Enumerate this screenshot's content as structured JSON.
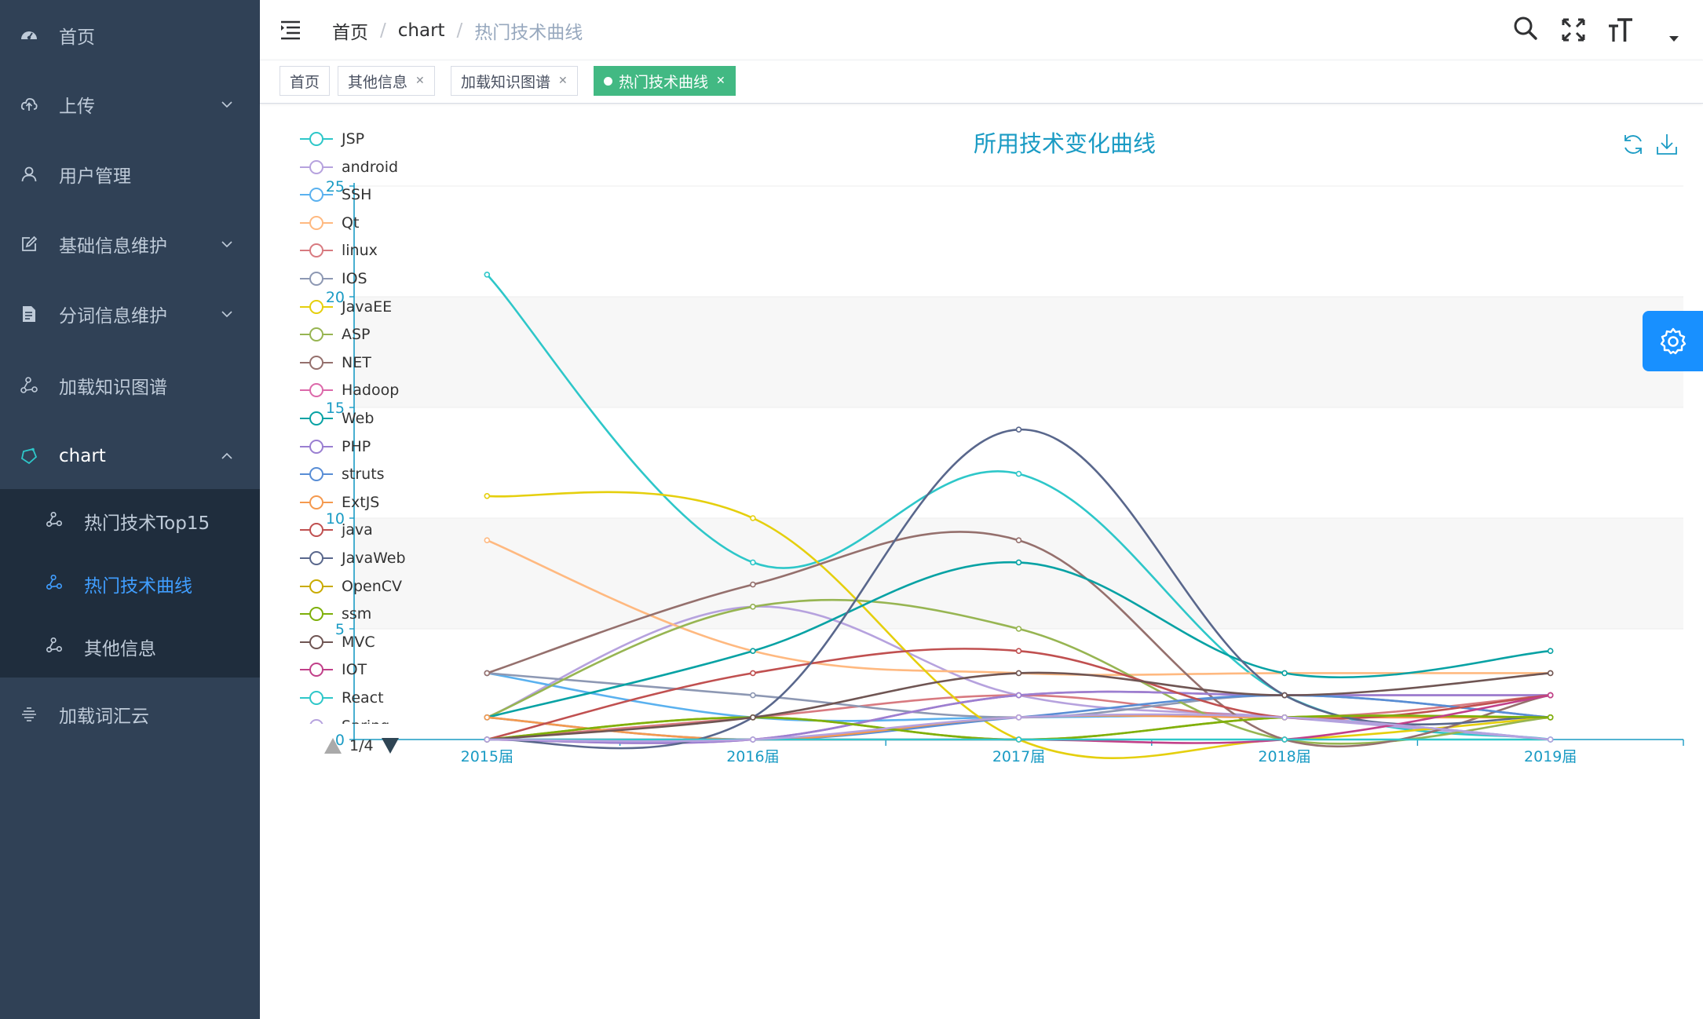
{
  "sidebar": {
    "items": [
      {
        "label": "首页",
        "icon": "dashboard-icon"
      },
      {
        "label": "上传",
        "icon": "upload-icon"
      },
      {
        "label": "用户管理",
        "icon": "user-icon"
      },
      {
        "label": "基础信息维护",
        "icon": "edit-icon"
      },
      {
        "label": "分词信息维护",
        "icon": "document-icon"
      },
      {
        "label": "加载知识图谱",
        "icon": "graph-icon"
      },
      {
        "label": "chart",
        "icon": "chart-icon"
      },
      {
        "label": "加载词汇云",
        "icon": "cloud-icon"
      }
    ],
    "chart_children": [
      {
        "label": "热门技术Top15"
      },
      {
        "label": "热门技术曲线"
      },
      {
        "label": "其他信息"
      }
    ]
  },
  "navbar": {
    "breadcrumb": [
      "首页",
      "chart",
      "热门技术曲线"
    ]
  },
  "tags": [
    "首页",
    "其他信息",
    "加载知识图谱",
    "热门技术曲线"
  ],
  "legend_pager": "1/4",
  "colors": {
    "sidebar_bg": "#304156",
    "submenu_bg": "#1f2d3d",
    "active_tag": "#42b983",
    "accent": "#409eff",
    "title": "#1a9bc4"
  },
  "chart_data": {
    "type": "line",
    "title": "所用技术变化曲线",
    "categories": [
      "2015届",
      "2016届",
      "2017届",
      "2018届",
      "2019届"
    ],
    "ylim": [
      0,
      25
    ],
    "yticks": [
      0,
      5,
      10,
      15,
      20,
      25
    ],
    "smooth": true,
    "grid": "horizontal-banded",
    "legend_position": "left",
    "series": [
      {
        "name": "JSP",
        "color": "#2ec7c9",
        "values": [
          21,
          8,
          12,
          2,
          0
        ]
      },
      {
        "name": "android",
        "color": "#b6a2de",
        "values": [
          1,
          6,
          2,
          1,
          0
        ]
      },
      {
        "name": "SSH",
        "color": "#5ab1ef",
        "values": [
          3,
          1,
          1,
          1,
          0
        ]
      },
      {
        "name": "Qt",
        "color": "#ffb980",
        "values": [
          9,
          4,
          3,
          3,
          3
        ]
      },
      {
        "name": "linux",
        "color": "#d87a80",
        "values": [
          0,
          1,
          2,
          1,
          2
        ]
      },
      {
        "name": "IOS",
        "color": "#8d98b3",
        "values": [
          3,
          2,
          1,
          2,
          1
        ]
      },
      {
        "name": "JavaEE",
        "color": "#e5cf0d",
        "values": [
          11,
          10,
          0,
          0,
          1
        ]
      },
      {
        "name": "ASP",
        "color": "#97b552",
        "values": [
          1,
          6,
          5,
          0,
          1
        ]
      },
      {
        "name": "NET",
        "color": "#95706d",
        "values": [
          3,
          7,
          9,
          0,
          2
        ]
      },
      {
        "name": "Hadoop",
        "color": "#dc69aa",
        "values": [
          0,
          0,
          2,
          2,
          2
        ]
      },
      {
        "name": "Web",
        "color": "#07a2a4",
        "values": [
          1,
          4,
          8,
          3,
          4
        ]
      },
      {
        "name": "PHP",
        "color": "#9a7fd1",
        "values": [
          0,
          0,
          2,
          2,
          2
        ]
      },
      {
        "name": "struts",
        "color": "#588dd5",
        "values": [
          1,
          0,
          1,
          2,
          1
        ]
      },
      {
        "name": "ExtJS",
        "color": "#f5994e",
        "values": [
          1,
          0,
          1,
          1,
          1
        ]
      },
      {
        "name": "java",
        "color": "#c05050",
        "values": [
          0,
          3,
          4,
          1,
          2
        ]
      },
      {
        "name": "JavaWeb",
        "color": "#59678c",
        "values": [
          0,
          1,
          14,
          2,
          1
        ]
      },
      {
        "name": "OpenCV",
        "color": "#c9ab00",
        "values": [
          0,
          1,
          0,
          1,
          1
        ]
      },
      {
        "name": "ssm",
        "color": "#7eb00a",
        "values": [
          0,
          1,
          0,
          1,
          1
        ]
      },
      {
        "name": "MVC",
        "color": "#6f5553",
        "values": [
          0,
          1,
          3,
          2,
          3
        ]
      },
      {
        "name": "IOT",
        "color": "#c14089",
        "values": [
          0,
          0,
          0,
          0,
          2
        ]
      },
      {
        "name": "React",
        "color": "#2ec7c9",
        "values": [
          0,
          0,
          0,
          0,
          0
        ]
      },
      {
        "name": "Spring",
        "color": "#b6a2de",
        "values": [
          0,
          0,
          1,
          1,
          0
        ]
      }
    ]
  }
}
